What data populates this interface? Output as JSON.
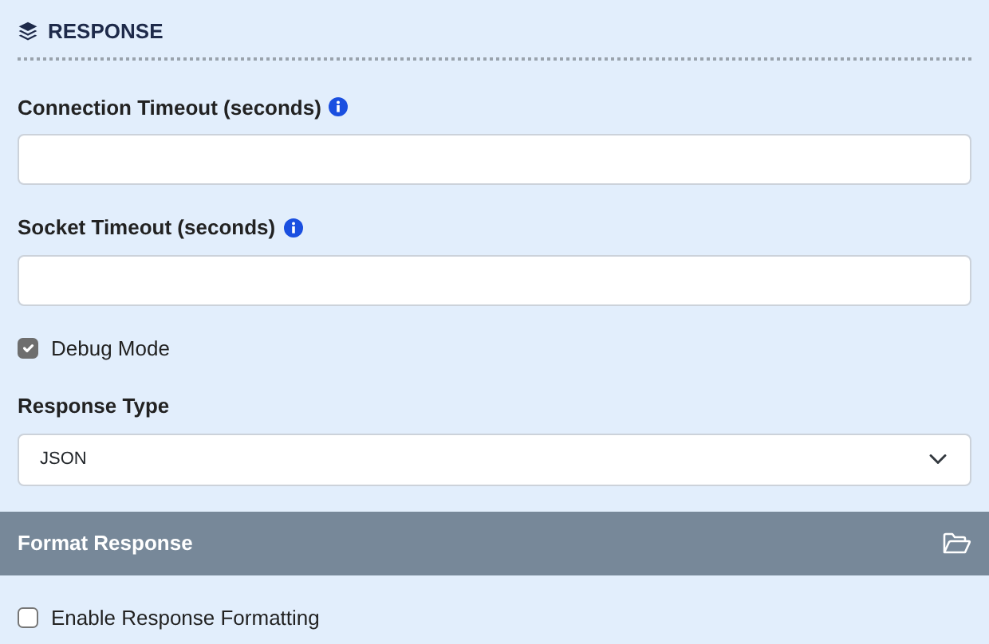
{
  "section": {
    "title": "RESPONSE"
  },
  "fields": [
    {
      "kind": "text",
      "label": "Connection Timeout (seconds)",
      "info": true
    },
    {
      "kind": "text",
      "label": "Socket Timeout (seconds)",
      "info": true
    },
    {
      "kind": "checkbox",
      "label": "Debug Mode",
      "checked": true
    },
    {
      "kind": "select",
      "label": "Response Type",
      "value": "JSON"
    }
  ],
  "panel": {
    "title": "Format Response",
    "fields": [
      {
        "kind": "checkbox",
        "label": "Enable Response Formatting",
        "checked": false
      }
    ]
  }
}
